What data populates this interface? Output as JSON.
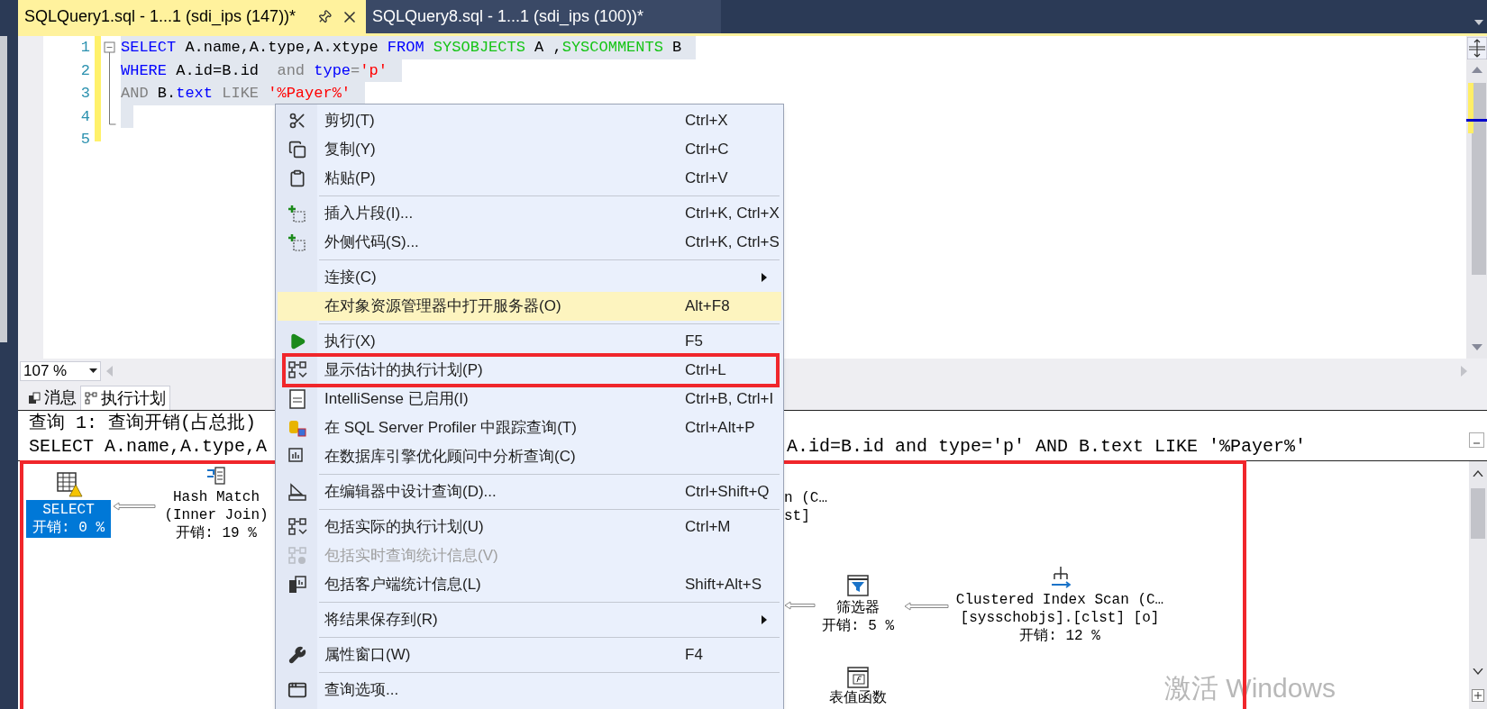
{
  "tabs": [
    {
      "title": "SQLQuery1.sql - 1...1 (sdi_ips (147))*",
      "selected": true
    },
    {
      "title": "SQLQuery8.sql - 1...1 (sdi_ips (100))*",
      "selected": false
    }
  ],
  "editor": {
    "lines": [
      {
        "number": "1",
        "selected": true,
        "tokens": [
          {
            "kind": "keyword",
            "text": "SELECT"
          },
          {
            "kind": "plain",
            "text": " A.name,A.type,A.xtype "
          },
          {
            "kind": "keyword",
            "text": "FROM"
          },
          {
            "kind": "object",
            "text": " SYSOBJECTS"
          },
          {
            "kind": "plain",
            "text": " A ,"
          },
          {
            "kind": "object",
            "text": "SYSCOMMENTS"
          },
          {
            "kind": "plain",
            "text": " B"
          }
        ]
      },
      {
        "number": "2",
        "selected": true,
        "tokens": [
          {
            "kind": "keyword",
            "text": "WHERE"
          },
          {
            "kind": "plain",
            "text": " A.id=B.id  "
          },
          {
            "kind": "operator",
            "text": "and"
          },
          {
            "kind": "keyword",
            "text": " type"
          },
          {
            "kind": "operator",
            "text": "="
          },
          {
            "kind": "string",
            "text": "'p'"
          }
        ]
      },
      {
        "number": "3",
        "selected": true,
        "tokens": [
          {
            "kind": "operator",
            "text": "AND"
          },
          {
            "kind": "plain",
            "text": " B."
          },
          {
            "kind": "keyword",
            "text": "text"
          },
          {
            "kind": "operator",
            "text": " LIKE"
          },
          {
            "kind": "string",
            "text": " '%Payer%'"
          }
        ]
      },
      {
        "number": "4",
        "selected": true
      },
      {
        "number": "5",
        "selected": false
      }
    ]
  },
  "zoom": {
    "value": "107 %"
  },
  "results_tabs": [
    {
      "label": "消息",
      "selected": false
    },
    {
      "label": "执行计划",
      "selected": true
    }
  ],
  "plan_header": {
    "line_1": "查询 1: 查询开销(占总批)",
    "line_2_left": "SELECT A.name,A.type,A",
    "line_2_right": "A.id=B.id and type='p' AND B.text LIKE '%Payer%'"
  },
  "plan": {
    "marked": true,
    "nodes": [
      {
        "kind": "select",
        "selected": true,
        "lines": [
          "SELECT",
          "开销: 0 %"
        ]
      },
      {
        "kind": "hash-match",
        "selected": false,
        "lines": [
          "Hash Match",
          "(Inner Join)",
          "开销: 19 %"
        ]
      },
      {
        "kind": "partial",
        "selected": false,
        "lines": [
          "n (C…",
          "st]"
        ]
      },
      {
        "kind": "filter",
        "selected": false,
        "lines": [
          "筛选器",
          "开销: 5 %"
        ]
      },
      {
        "kind": "clustered-index-scan",
        "selected": false,
        "lines": [
          "Clustered Index Scan (C…",
          "[sysschobjs].[clst] [o]",
          "开销: 12 %"
        ]
      },
      {
        "kind": "table-function",
        "selected": false,
        "lines": [
          "表值函数"
        ]
      }
    ]
  },
  "activation_notice": "激活 Windows",
  "context_menu": {
    "items": [
      {
        "kind": "item",
        "label": "剪切(T)",
        "shortcut": "Ctrl+X",
        "selected": false,
        "disabled": false,
        "submenu": false,
        "marked": false
      },
      {
        "kind": "item",
        "label": "复制(Y)",
        "shortcut": "Ctrl+C",
        "selected": false,
        "disabled": false,
        "submenu": false,
        "marked": false
      },
      {
        "kind": "item",
        "label": "粘贴(P)",
        "shortcut": "Ctrl+V",
        "selected": false,
        "disabled": false,
        "submenu": false,
        "marked": false
      },
      {
        "kind": "separator"
      },
      {
        "kind": "item",
        "label": "插入片段(I)...",
        "shortcut": "Ctrl+K, Ctrl+X",
        "selected": false,
        "disabled": false,
        "submenu": false,
        "marked": false
      },
      {
        "kind": "item",
        "label": "外侧代码(S)...",
        "shortcut": "Ctrl+K, Ctrl+S",
        "selected": false,
        "disabled": false,
        "submenu": false,
        "marked": false
      },
      {
        "kind": "separator"
      },
      {
        "kind": "item",
        "label": "连接(C)",
        "selected": false,
        "disabled": false,
        "submenu": true,
        "marked": false
      },
      {
        "kind": "item",
        "label": "在对象资源管理器中打开服务器(O)",
        "shortcut": "Alt+F8",
        "selected": true,
        "disabled": false,
        "submenu": false,
        "marked": false
      },
      {
        "kind": "separator"
      },
      {
        "kind": "item",
        "label": "执行(X)",
        "shortcut": "F5",
        "selected": false,
        "disabled": false,
        "submenu": false,
        "marked": false
      },
      {
        "kind": "item",
        "label": "显示估计的执行计划(P)",
        "shortcut": "Ctrl+L",
        "selected": false,
        "disabled": false,
        "submenu": false,
        "marked": true
      },
      {
        "kind": "item",
        "label": "IntelliSense 已启用(I)",
        "shortcut": "Ctrl+B, Ctrl+I",
        "selected": false,
        "disabled": false,
        "submenu": false,
        "marked": false
      },
      {
        "kind": "item",
        "label": "在 SQL Server Profiler 中跟踪查询(T)",
        "shortcut": "Ctrl+Alt+P",
        "selected": false,
        "disabled": false,
        "submenu": false,
        "marked": false
      },
      {
        "kind": "item",
        "label": "在数据库引擎优化顾问中分析查询(C)",
        "selected": false,
        "disabled": false,
        "submenu": false,
        "marked": false
      },
      {
        "kind": "separator"
      },
      {
        "kind": "item",
        "label": "在编辑器中设计查询(D)...",
        "shortcut": "Ctrl+Shift+Q",
        "selected": false,
        "disabled": false,
        "submenu": false,
        "marked": false
      },
      {
        "kind": "separator"
      },
      {
        "kind": "item",
        "label": "包括实际的执行计划(U)",
        "shortcut": "Ctrl+M",
        "selected": false,
        "disabled": false,
        "submenu": false,
        "marked": false
      },
      {
        "kind": "item",
        "label": "包括实时查询统计信息(V)",
        "selected": false,
        "disabled": true,
        "submenu": false,
        "marked": false
      },
      {
        "kind": "item",
        "label": "包括客户端统计信息(L)",
        "shortcut": "Shift+Alt+S",
        "selected": false,
        "disabled": false,
        "submenu": false,
        "marked": false
      },
      {
        "kind": "separator"
      },
      {
        "kind": "item",
        "label": "将结果保存到(R)",
        "selected": false,
        "disabled": false,
        "submenu": true,
        "marked": false
      },
      {
        "kind": "separator"
      },
      {
        "kind": "item",
        "label": "属性窗口(W)",
        "shortcut": "F4",
        "selected": false,
        "disabled": false,
        "submenu": false,
        "marked": false
      },
      {
        "kind": "separator"
      },
      {
        "kind": "item",
        "label": "查询选项...",
        "selected": false,
        "disabled": false,
        "submenu": false,
        "marked": false
      }
    ]
  }
}
